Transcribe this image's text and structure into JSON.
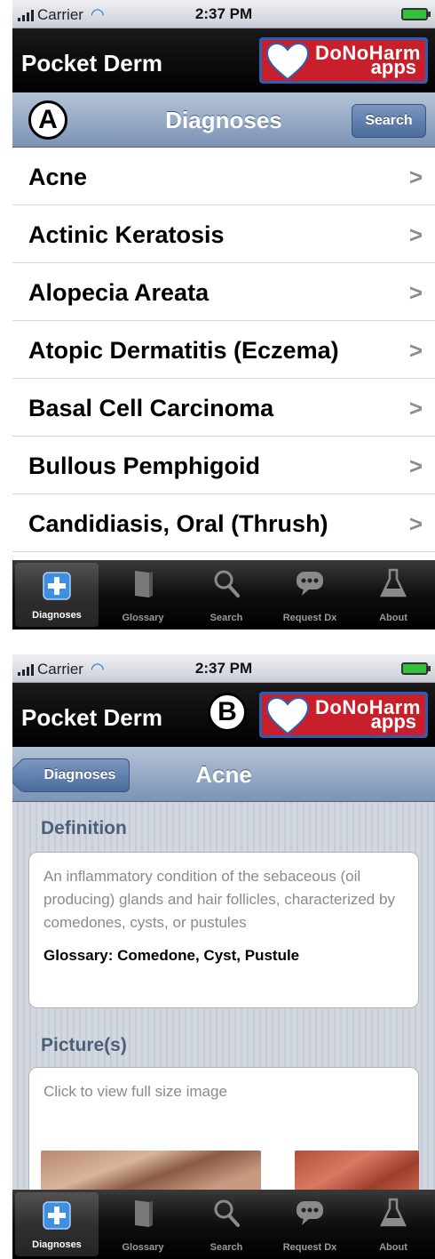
{
  "status": {
    "carrier": "Carrier",
    "time": "2:37 PM"
  },
  "app": {
    "title": "Pocket Derm",
    "logo_top": "DoNoHarm",
    "logo_bottom": "apps"
  },
  "screen_a": {
    "marker": "A",
    "nav_title": "Diagnoses",
    "search_button": "Search",
    "rows": [
      "Acne",
      "Actinic Keratosis",
      "Alopecia Areata",
      "Atopic Dermatitis (Eczema)",
      "Basal Cell Carcinoma",
      "Bullous Pemphigoid",
      "Candidiasis, Oral (Thrush)"
    ],
    "chevron": ">"
  },
  "screen_b": {
    "marker": "B",
    "back_button": "Diagnoses",
    "nav_title": "Acne",
    "definition_heading": "Definition",
    "definition_text": "An inflammatory condition of the sebaceous (oil producing) glands and hair follicles, characterized by comedones, cysts, or pustules",
    "glossary": "Glossary: Comedone, Cyst, Pustule",
    "pictures_heading": "Picture(s)",
    "pictures_hint": "Click to view full size image"
  },
  "tabbar": {
    "active": "Diagnoses",
    "tabs": [
      {
        "label": "Diagnoses",
        "icon": "plus-icon"
      },
      {
        "label": "Glossary",
        "icon": "book-icon"
      },
      {
        "label": "Search",
        "icon": "magnifier-icon"
      },
      {
        "label": "Request Dx",
        "icon": "chat-bubble-icon"
      },
      {
        "label": "About",
        "icon": "flask-icon"
      }
    ]
  },
  "colors": {
    "accent_blue": "#2d5fb5",
    "logo_red": "#c81f2a",
    "nav_blue": "#7c93b4"
  }
}
